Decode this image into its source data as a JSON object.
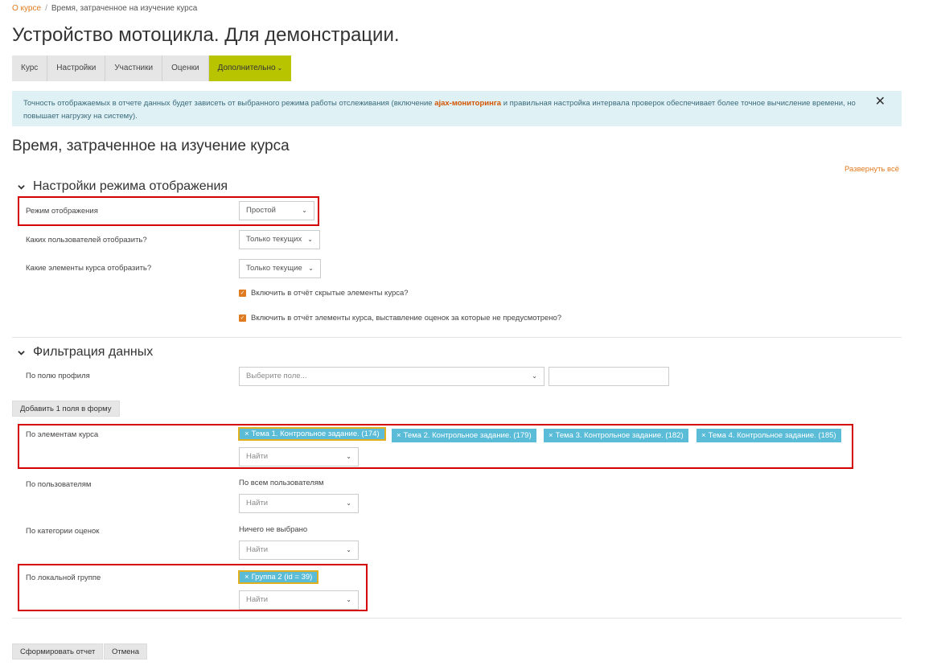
{
  "breadcrumb": {
    "link": "О курсе",
    "separator": "/",
    "current": "Время, затраченное на изучение курса"
  },
  "page_title": "Устройство мотоцикла. Для демонстрации.",
  "tabs": [
    "Курс",
    "Настройки",
    "Участники",
    "Оценки",
    "Дополнительно"
  ],
  "tab_caret": "⌄",
  "alert": {
    "text_before": "Точность отображаемых в отчете данных будет зависеть от выбранного режима работы отслеживания (включение ",
    "highlight": "ajax-мониторинга",
    "text_after": " и правильная настройка интервала проверок обеспечивает более точное вычисление времени, но повышает нагрузку на систему).",
    "close": "✕"
  },
  "report_heading": "Время, затраченное на изучение курса",
  "expand_all": "Развернуть всё",
  "display_section": {
    "title": "Настройки режима отображения",
    "mode": {
      "label": "Режим отображения",
      "value": "Простой"
    },
    "users": {
      "label": "Каких пользователей отобразить?",
      "value": "Только текущих"
    },
    "elements": {
      "label": "Какие элементы курса отобразить?",
      "value": "Только текущие"
    },
    "check_hidden": "Включить в отчёт скрытые элементы курса?",
    "check_ungraded": "Включить в отчёт элементы курса, выставление оценок за которые не предусмотрено?"
  },
  "filter_section": {
    "title": "Фильтрация данных",
    "profile": {
      "label": "По полю профиля",
      "placeholder": "Выберите поле..."
    },
    "add_field_button": "Добавить 1 поля в форму",
    "course_elements": {
      "label": "По элементам курса",
      "tags": [
        "Тема 1. Контрольное задание. (174)",
        "Тема 2. Контрольное задание. (179)",
        "Тема 3. Контрольное задание. (182)",
        "Тема 4. Контрольное задание. (185)"
      ],
      "search_placeholder": "Найти"
    },
    "users": {
      "label": "По пользователям",
      "current": "По всем пользователям",
      "search_placeholder": "Найти"
    },
    "grade_categories": {
      "label": "По категории оценок",
      "current": "Ничего не выбрано",
      "search_placeholder": "Найти"
    },
    "local_group": {
      "label": "По локальной группе",
      "tags": [
        "Группа 2 (id = 39)"
      ],
      "search_placeholder": "Найти"
    }
  },
  "tag_remove": "×",
  "dropdown_arrow": "⌄",
  "checkmark": "✓",
  "buttons": {
    "submit": "Сформировать отчет",
    "cancel": "Отмена"
  },
  "colors": {
    "accent": "#e07a1f",
    "active_tab": "#b8c400",
    "tag": "#5bbcd7",
    "alert_bg": "#dff1f5",
    "highlight_box": "#d40000"
  }
}
